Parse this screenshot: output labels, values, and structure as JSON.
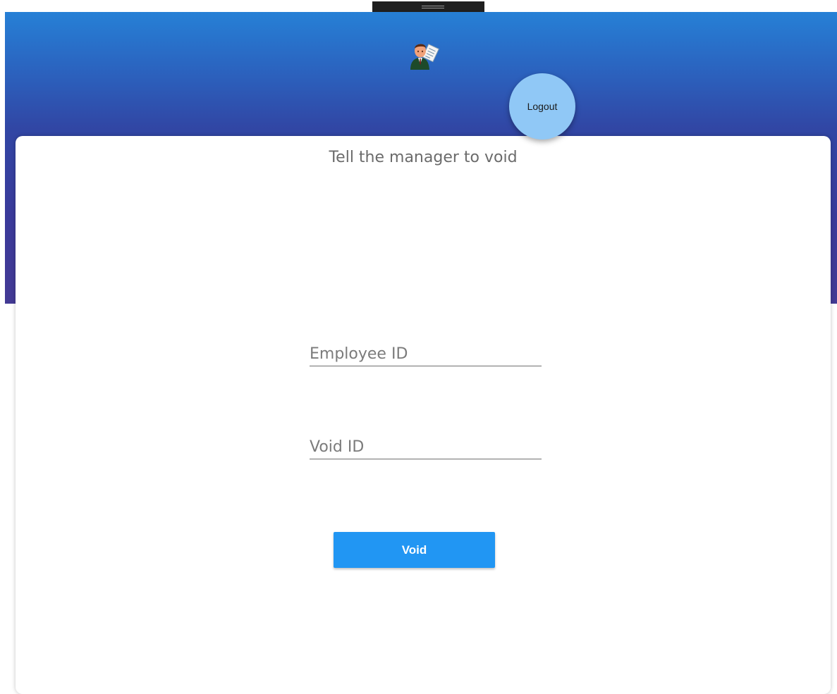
{
  "header": {
    "avatar_icon": "businessman-avatar-icon",
    "logout_label": "Logout"
  },
  "card": {
    "title": "Tell the manager to void"
  },
  "form": {
    "employee_id": {
      "placeholder": "Employee ID",
      "value": ""
    },
    "void_id": {
      "placeholder": "Void ID",
      "value": ""
    },
    "submit_label": "Void"
  },
  "colors": {
    "header_top": "#2680d6",
    "header_bottom": "#433a94",
    "logout_bg": "#90c8f6",
    "primary": "#2196f3"
  }
}
